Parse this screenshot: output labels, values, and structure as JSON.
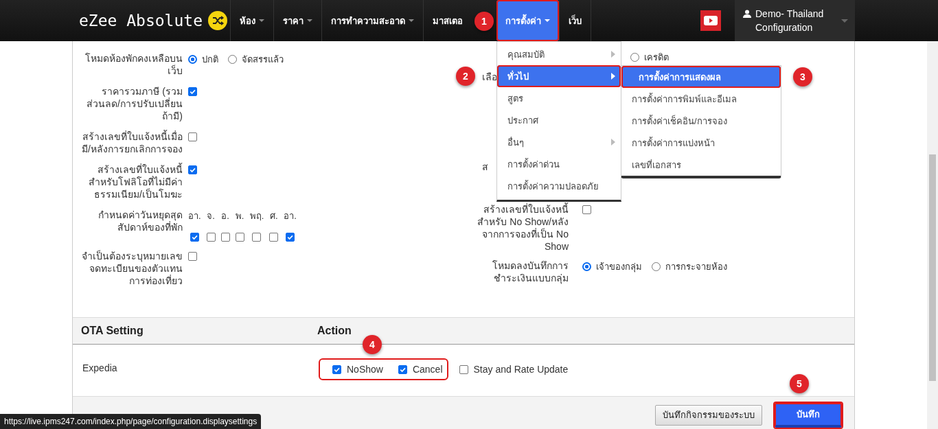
{
  "navbar": {
    "logo": "eZee Absolute",
    "items": [
      {
        "label": "ห้อง",
        "caret": true,
        "selected": false,
        "outlined": false
      },
      {
        "label": "ราคา",
        "caret": true,
        "selected": false,
        "outlined": false
      },
      {
        "label": "การทำความสะอาด",
        "caret": true,
        "selected": false,
        "outlined": false
      },
      {
        "label": "มาสเตอ",
        "caret": false,
        "selected": false,
        "outlined": false
      },
      {
        "label": "การตั้งค่า",
        "caret": true,
        "selected": true,
        "outlined": true,
        "badge": "1"
      },
      {
        "label": "เว็บ",
        "caret": false,
        "selected": false,
        "outlined": false
      }
    ],
    "user": [
      "Demo- Thailand",
      "Configuration"
    ]
  },
  "menu": {
    "items": [
      {
        "label": "คุณสมบัติ",
        "submenu": true,
        "selected": false,
        "outlined": false
      },
      {
        "label": "ทั่วไป",
        "submenu": true,
        "selected": true,
        "outlined": true,
        "badge": "2"
      },
      {
        "label": "สูตร",
        "submenu": false,
        "selected": false,
        "outlined": false
      },
      {
        "label": "ประกาศ",
        "submenu": false,
        "selected": false,
        "outlined": false
      },
      {
        "label": "อื่นๆ",
        "submenu": true,
        "selected": false,
        "outlined": false
      },
      {
        "label": "การตั้งค่าด่วน",
        "submenu": false,
        "selected": false,
        "outlined": false
      },
      {
        "label": "การตั้งค่าความปลอดภัย",
        "submenu": false,
        "selected": false,
        "outlined": false
      }
    ]
  },
  "submenu": {
    "items": [
      {
        "label": "การตั้งค่าการแสดงผล",
        "selected": true,
        "outlined": true,
        "badge": "3"
      },
      {
        "label": "การตั้งค่าการพิมพ์และอีเมล",
        "selected": false,
        "outlined": false
      },
      {
        "label": "การตั้งค่าเช็คอิน/การจอง",
        "selected": false,
        "outlined": false
      },
      {
        "label": "การตั้งค่าการแบ่งหน้า",
        "selected": false,
        "outlined": false
      },
      {
        "label": "เลขที่เอกสาร",
        "selected": false,
        "outlined": false
      }
    ]
  },
  "form_left": [
    {
      "label": "โหมดห้องพักคงเหลือบนเว็บ",
      "kind": "radio",
      "options": [
        {
          "label": "ปกติ",
          "selected": true
        },
        {
          "label": "จัดสรรแล้ว",
          "selected": false
        }
      ]
    },
    {
      "label": "ราคารวมภาษี (รวมส่วนลด/การปรับเปลี่ยนถ้ามี)",
      "kind": "checkbox",
      "checked": true
    },
    {
      "label": "สร้างเลขที่ใบแจ้งหนี้เมื่อมี/หลังการยกเลิกการจอง",
      "kind": "checkbox",
      "checked": false
    },
    {
      "label": "สร้างเลขที่ใบแจ้งหนี้สำหรับโฟลิโอที่ไม่มีค่าธรรมเนียม/เป็นโมฆะ",
      "kind": "checkbox",
      "checked": true
    },
    {
      "label": "กำหนดค่าวันหยุดสุดสัปดาห์ของที่พัก",
      "kind": "days",
      "days": [
        {
          "label": "อา.",
          "checked": true
        },
        {
          "label": "จ.",
          "checked": false
        },
        {
          "label": "อ.",
          "checked": false
        },
        {
          "label": "พ.",
          "checked": false
        },
        {
          "label": "พฤ.",
          "checked": false
        },
        {
          "label": "ศ.",
          "checked": false
        },
        {
          "label": "อา.",
          "checked": true
        }
      ]
    },
    {
      "label": "จำเป็นต้องระบุหมายเลขจดทะเบียนของตัวแทนการท่องเที่ยว",
      "kind": "checkbox",
      "checked": false
    }
  ],
  "form_right": [
    {
      "kind": "radio",
      "options": [
        {
          "label": "เครดิต",
          "selected": false
        }
      ]
    },
    {
      "label": "เลือ",
      "kind": "label"
    },
    {
      "label": "ส",
      "kind": "label"
    },
    {
      "label": "สร้างเลขที่ใบแจ้งหนี้สำหรับ No Show/หลังจากการจองที่เป็น No Show",
      "kind": "checkbox",
      "checked": false
    },
    {
      "label": "โหมดลงบันทึกการชำระเงินแบบกลุ่ม",
      "kind": "radio",
      "options": [
        {
          "label": "เจ้าของกลุ่ม",
          "selected": true
        },
        {
          "label": "การกระจายห้อง",
          "selected": false
        }
      ]
    }
  ],
  "ota": {
    "heading": "OTA Setting",
    "action_heading": "Action",
    "rows": [
      {
        "name": "Expedia",
        "groups": [
          {
            "outlined": true,
            "badge": "4",
            "options": [
              {
                "label": "NoShow",
                "checked": true
              },
              {
                "label": "Cancel",
                "checked": true
              }
            ]
          },
          {
            "outlined": false,
            "options": [
              {
                "label": "Stay and Rate Update",
                "checked": false
              }
            ]
          }
        ]
      }
    ]
  },
  "footer": {
    "buttons": [
      {
        "label": "บันทึกกิจกรรมของระบบ",
        "kind": "secondary",
        "outlined": false
      },
      {
        "label": "บันทึก",
        "kind": "primary",
        "outlined": true,
        "badge": "5"
      }
    ]
  },
  "status_url": "https://live.ipms247.com/index.php/page/configuration.displaysettings"
}
